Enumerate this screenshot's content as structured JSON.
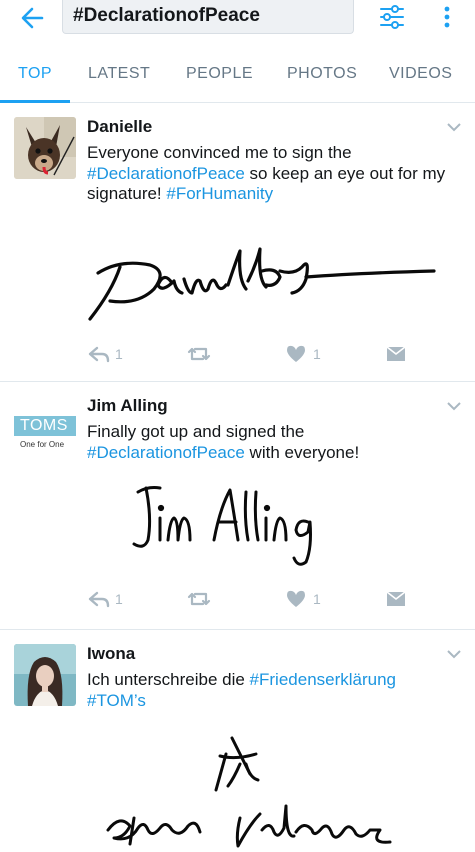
{
  "search": {
    "query": "#DeclarationofPeace"
  },
  "tabs": [
    {
      "label": "TOP",
      "active": true
    },
    {
      "label": "LATEST"
    },
    {
      "label": "PEOPLE"
    },
    {
      "label": "PHOTOS"
    },
    {
      "label": "VIDEOS"
    }
  ],
  "tweets": [
    {
      "name": "Danielle",
      "text_1": "Everyone convinced me to sign the ",
      "tag_1": "#DeclarationofPeace",
      "text_2": " so keep an eye out for my signature! ",
      "tag_2": "#ForHumanity",
      "signature": "Danielle",
      "reply_count": "1",
      "like_count": "1"
    },
    {
      "name": "Jim Alling",
      "avatar_text": "TOMS",
      "avatar_subtext": "One for One",
      "text_1": "Finally got up and signed the ",
      "tag_1": "#DeclarationofPeace",
      "text_2": " with everyone!",
      "signature": "Jim Alling",
      "reply_count": "1",
      "like_count": "1"
    },
    {
      "name": "Iwona",
      "text_1": "Ich unterschreibe die ",
      "tag_1": "#Friedenserklärung",
      "text_2": " ",
      "tag_2": "#TOM’s",
      "signature": "Iwona Valdez"
    }
  ],
  "colors": {
    "accent": "#1da1f2",
    "link": "#1b95e0",
    "muted": "#aab8c2"
  }
}
